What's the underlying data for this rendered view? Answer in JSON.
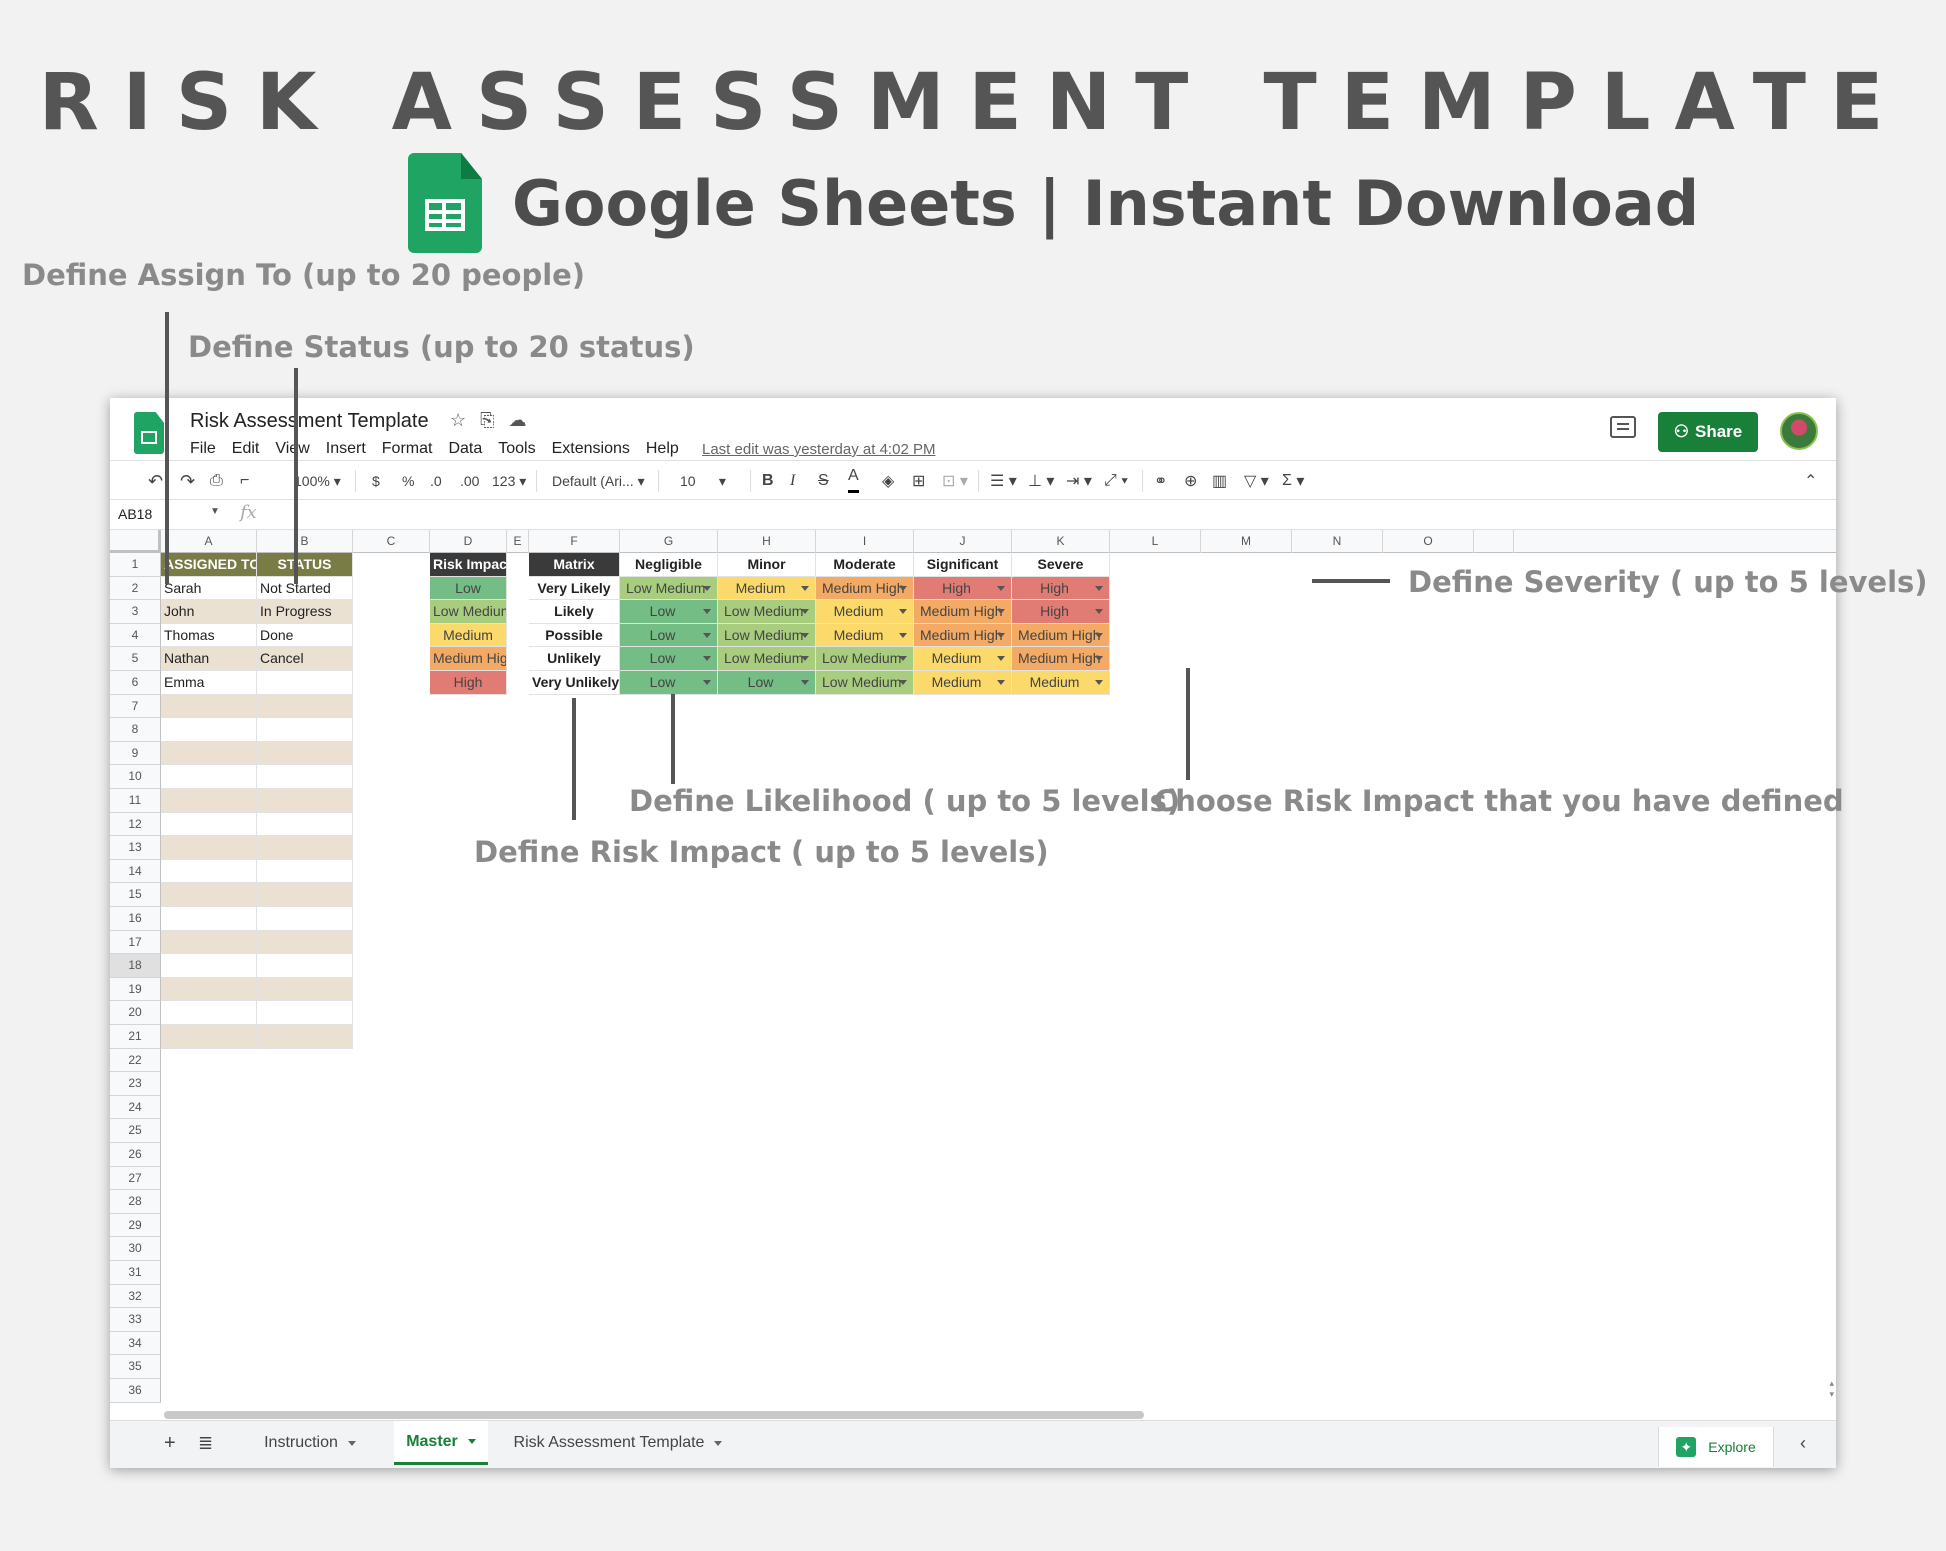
{
  "hero": {
    "title": "RISK ASSESSMENT TEMPLATE",
    "subtitle": "Google Sheets | Instant Download"
  },
  "annotations": {
    "assign_to": "Define Assign To (up to 20 people)",
    "status": "Define Status (up to 20 status)",
    "severity": "Define Severity ( up to 5 levels)",
    "likelihood": "Define Likelihood ( up to 5 levels)",
    "choose_impact": "Choose Risk Impact that you have defined",
    "risk_impact": "Define Risk Impact ( up to 5 levels)"
  },
  "colors": {
    "low": "#74bd85",
    "low_medium": "#a9cd7f",
    "medium": "#fbd96b",
    "medium_high": "#f3aa64",
    "high": "#e07c73",
    "header_olive": "#7a7c45",
    "header_dark": "#3a3a3a",
    "stripe": "#ebe1d3",
    "share_green": "#188038"
  },
  "app": {
    "doc_title": "Risk Assessment Template",
    "menu": [
      "File",
      "Edit",
      "View",
      "Insert",
      "Format",
      "Data",
      "Tools",
      "Extensions",
      "Help"
    ],
    "last_edit": "Last edit was yesterday at 4:02 PM",
    "share_label": "Share",
    "title_icons": [
      "star-icon",
      "move-folder-icon",
      "cloud-status-icon"
    ]
  },
  "toolbar": {
    "zoom": "100%",
    "currency": "$",
    "percent": "%",
    "dec_decrease": ".0",
    "dec_increase": ".00",
    "more_formats": "123",
    "font": "Default (Ari...",
    "font_size": "10",
    "bold": "B",
    "italic": "I",
    "strike": "S",
    "text_color": "A",
    "sum": "Σ"
  },
  "formula_bar": {
    "name_box": "AB18",
    "fx": "fx"
  },
  "columns": [
    "A",
    "B",
    "C",
    "D",
    "E",
    "F",
    "G",
    "H",
    "I",
    "J",
    "K",
    "L",
    "M",
    "N",
    "O"
  ],
  "selected_row": 18,
  "row_count": 36,
  "assign_table": {
    "headers": [
      "ASSIGNED TO",
      "STATUS"
    ],
    "names": [
      "Sarah",
      "John",
      "Thomas",
      "Nathan",
      "Emma"
    ],
    "statuses": [
      "Not Started",
      "In Progress",
      "Done",
      "Cancel"
    ],
    "filled_rows": 21
  },
  "risk_impact": {
    "header": "Risk Impact",
    "levels": [
      "Low",
      "Low Medium",
      "Medium",
      "Medium High",
      "High"
    ]
  },
  "matrix": {
    "header": "Matrix",
    "severity": [
      "Negligible",
      "Minor",
      "Moderate",
      "Significant",
      "Severe"
    ],
    "likelihood": [
      "Very Likely",
      "Likely",
      "Possible",
      "Unlikely",
      "Very Unlikely"
    ],
    "cells": [
      [
        "Low Medium",
        "Medium",
        "Medium High",
        "High",
        "High"
      ],
      [
        "Low",
        "Low Medium",
        "Medium",
        "Medium High",
        "High"
      ],
      [
        "Low",
        "Low Medium",
        "Medium",
        "Medium High",
        "Medium High"
      ],
      [
        "Low",
        "Low Medium",
        "Low Medium",
        "Medium",
        "Medium High"
      ],
      [
        "Low",
        "Low",
        "Low Medium",
        "Medium",
        "Medium"
      ]
    ]
  },
  "sheet_tabs": [
    "Instruction",
    "Master",
    "Risk Assessment Template"
  ],
  "active_tab": "Master",
  "explore_label": "Explore"
}
